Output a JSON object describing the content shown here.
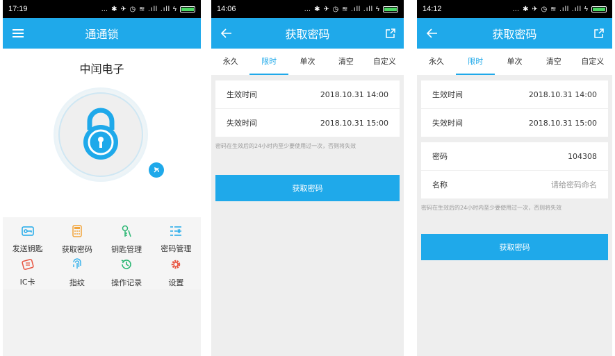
{
  "phone1": {
    "status_time": "17:19",
    "status_icons": "… ✱ ✈ ◷ ≋ .ıll .ıll ϟ",
    "title": "通通锁",
    "company": "中闰电子",
    "grid": [
      {
        "label": "发送钥匙",
        "icon": "send-key-icon"
      },
      {
        "label": "获取密码",
        "icon": "calculator-icon"
      },
      {
        "label": "钥匙管理",
        "icon": "key-manage-icon"
      },
      {
        "label": "密码管理",
        "icon": "list-manage-icon"
      },
      {
        "label": "IC卡",
        "icon": "ic-card-icon"
      },
      {
        "label": "指纹",
        "icon": "fingerprint-icon"
      },
      {
        "label": "操作记录",
        "icon": "history-icon"
      },
      {
        "label": "设置",
        "icon": "gear-icon"
      }
    ]
  },
  "phone2": {
    "status_time": "14:06",
    "status_icons": "… ✱ ✈ ◷ ≋ .ıll .ıll ϟ",
    "title": "获取密码",
    "tabs": [
      "永久",
      "限时",
      "单次",
      "清空",
      "自定义"
    ],
    "active_tab": "限时",
    "rows": [
      {
        "label": "生效时间",
        "value": "2018.10.31 14:00"
      },
      {
        "label": "失效时间",
        "value": "2018.10.31 15:00"
      }
    ],
    "hint": "密码在生效后的24小时内至少要使用过一次，否则将失效",
    "button": "获取密码"
  },
  "phone3": {
    "status_time": "14:12",
    "status_icons": "… ✱ ✈ ◷ ≋ .ıll .ıll ϟ",
    "title": "获取密码",
    "tabs": [
      "永久",
      "限时",
      "单次",
      "清空",
      "自定义"
    ],
    "active_tab": "限时",
    "rows": [
      {
        "label": "生效时间",
        "value": "2018.10.31 14:00"
      },
      {
        "label": "失效时间",
        "value": "2018.10.31 15:00"
      }
    ],
    "rows2": [
      {
        "label": "密码",
        "value": "104308"
      },
      {
        "label": "名称",
        "placeholder": "请给密码命名"
      }
    ],
    "hint": "密码在生效后的24小时内至少要使用过一次，否则将失效",
    "button": "获取密码"
  },
  "colors": {
    "accent": "#1fa9ea",
    "orange": "#f2a43a",
    "green": "#2bb673",
    "red": "#e8533f"
  }
}
